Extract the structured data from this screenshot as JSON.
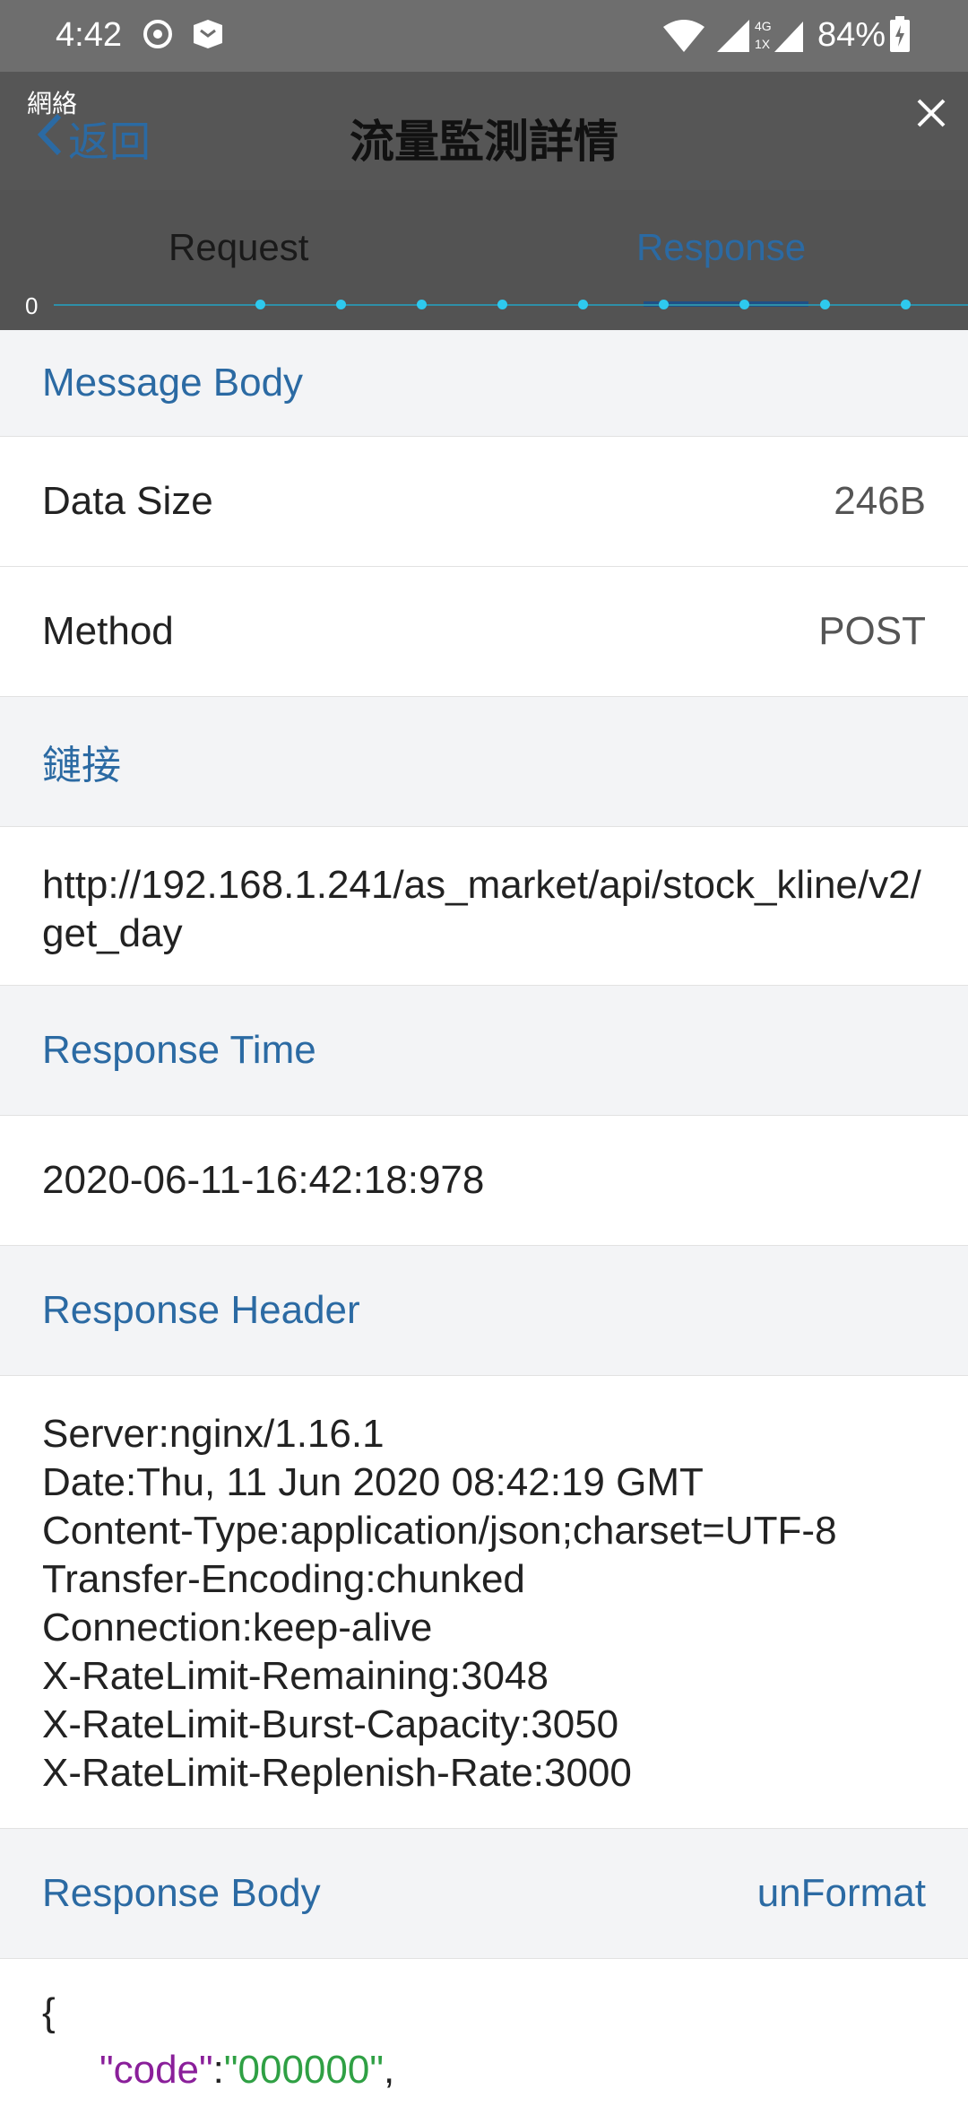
{
  "status_bar": {
    "time": "4:42",
    "battery_percent": "84%",
    "icons": [
      "notification-swirl-icon",
      "app-notification-icon",
      "wifi-icon",
      "cell-signal-icon",
      "4g-1x-signal-icon",
      "battery-charging-icon"
    ]
  },
  "navbar": {
    "network_label": "網絡",
    "back_label": "返回",
    "title": "流量監測詳情",
    "close_icon": "close-icon"
  },
  "tabs": {
    "request": "Request",
    "response": "Response",
    "active": "Response",
    "axis_zero": "0"
  },
  "sections": {
    "message_body": "Message Body",
    "data_size_key": "Data Size",
    "data_size_val": "246B",
    "method_key": "Method",
    "method_val": "POST",
    "link_header": "鏈接",
    "link_url": "http://192.168.1.241/as_market/api/stock_kline/v2/get_day",
    "response_time_header": "Response Time",
    "response_time_val": "2020-06-11-16:42:18:978",
    "response_header_title": "Response Header",
    "response_header_lines": [
      "Server:nginx/1.16.1",
      "Date:Thu, 11 Jun 2020 08:42:19 GMT",
      "Content-Type:application/json;charset=UTF-8",
      "Transfer-Encoding:chunked",
      "Connection:keep-alive",
      "X-RateLimit-Remaining:3048",
      "X-RateLimit-Burst-Capacity:3050",
      "X-RateLimit-Replenish-Rate:3000"
    ],
    "response_body_title": "Response Body",
    "unformat_label": "unFormat",
    "json_open": "{",
    "json_first_key": "\"code\"",
    "json_colon": ":",
    "json_first_val": "\"000000\"",
    "json_comma": ","
  },
  "colors": {
    "accent": "#2b6aa3",
    "overlay": "#565656",
    "section_bg": "#f3f4f6",
    "json_key": "#8a1f9a",
    "json_value": "#2fa044",
    "axis_dot": "#2ec9ee"
  }
}
